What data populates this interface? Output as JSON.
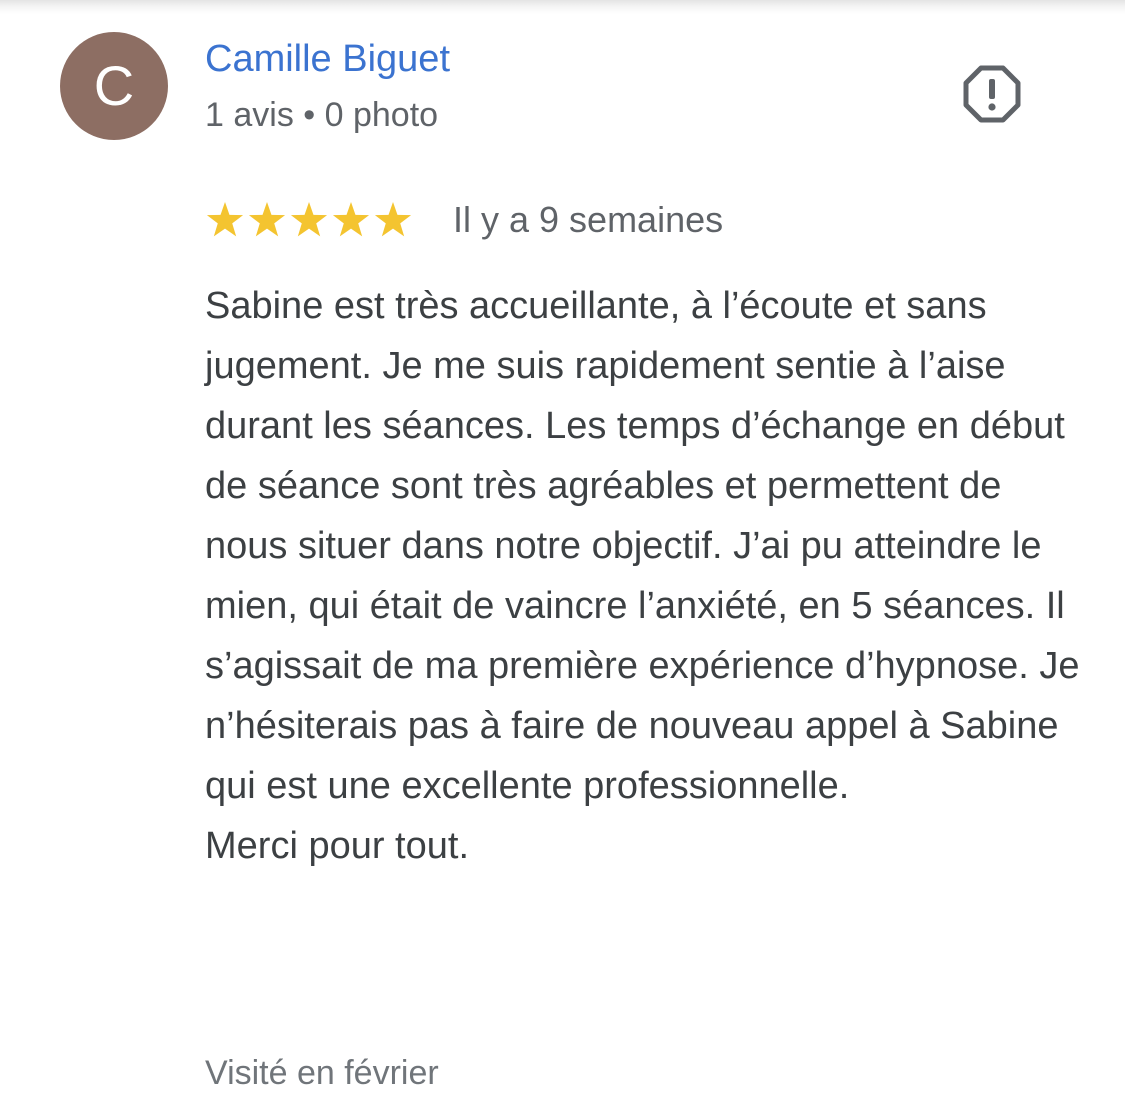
{
  "author": {
    "initial": "C",
    "name": "Camille Biguet",
    "meta": "1 avis • 0 photo",
    "avatar_color": "#8d6e63",
    "name_color": "#3b73d0"
  },
  "report": {
    "icon": "report-flag-icon"
  },
  "rating": {
    "stars": 5,
    "max_stars": 5,
    "star_color": "#f4c430",
    "date": "Il y a 9 semaines"
  },
  "review": {
    "paragraphs": [
      "Sabine est très accueillante, à l’écoute et sans jugement. Je me suis rapidement sentie à l’aise durant les séances. Les temps d’échange en début de séance sont très agréables et permettent de nous situer dans notre objectif. J’ai pu atteindre le mien, qui était de vaincre l’anxiété, en 5 séances. Il s’agissait de ma première expérience d’hypnose. Je n’hésiterais pas à faire de nouveau appel à Sabine qui est une excellente professionnelle.",
      "Merci pour tout."
    ]
  },
  "visited": "Visité en février"
}
